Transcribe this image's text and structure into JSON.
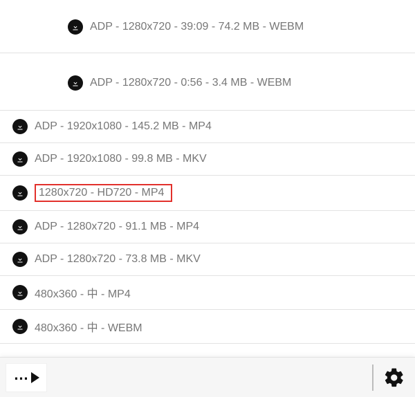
{
  "items": [
    {
      "variant": "big",
      "label": "ADP - 1280x720 - 39:09 - 74.2 MB - WEBM",
      "highlighted": false
    },
    {
      "variant": "big",
      "label": "ADP - 1280x720 - 0:56 - 3.4 MB - WEBM",
      "highlighted": false
    },
    {
      "variant": "row",
      "label": "ADP - 1920x1080 - 145.2 MB - MP4",
      "highlighted": false
    },
    {
      "variant": "row",
      "label": "ADP - 1920x1080 - 99.8 MB - MKV",
      "highlighted": false
    },
    {
      "variant": "row",
      "label": "1280x720 - HD720 - MP4",
      "highlighted": true
    },
    {
      "variant": "row",
      "label": "ADP - 1280x720 - 91.1 MB - MP4",
      "highlighted": false
    },
    {
      "variant": "row",
      "label": "ADP - 1280x720 - 73.8 MB - MKV",
      "highlighted": false
    },
    {
      "variant": "row",
      "label": "480x360 - 中 - MP4",
      "highlighted": false
    },
    {
      "variant": "row",
      "label": "480x360 - 中 - WEBM",
      "highlighted": false
    }
  ],
  "icons": {
    "download": "download-icon",
    "gear": "gear-icon",
    "more": "more-menu"
  }
}
